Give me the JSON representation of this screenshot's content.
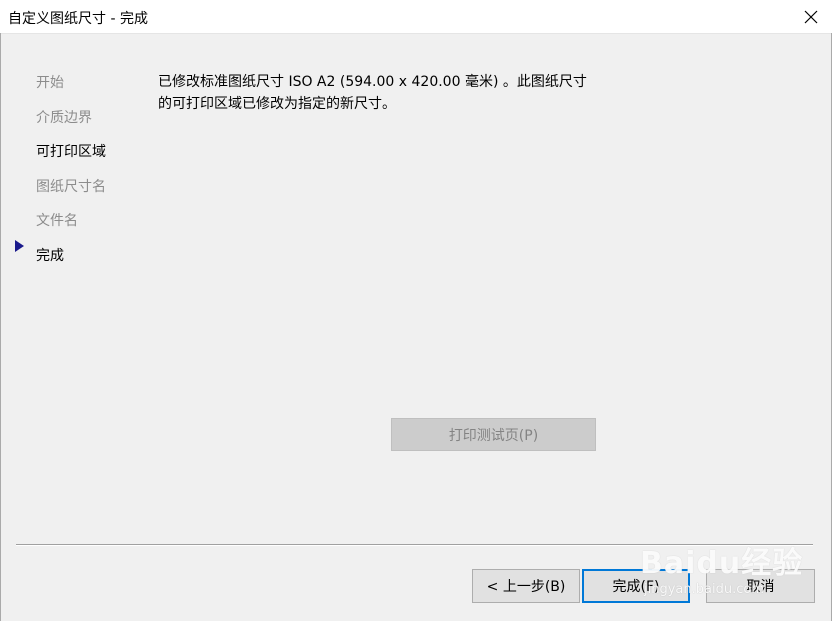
{
  "window": {
    "title": "自定义图纸尺寸 - 完成"
  },
  "steps": [
    {
      "label": "开始",
      "state": "disabled"
    },
    {
      "label": "介质边界",
      "state": "disabled"
    },
    {
      "label": "可打印区域",
      "state": "enabled"
    },
    {
      "label": "图纸尺寸名",
      "state": "disabled"
    },
    {
      "label": "文件名",
      "state": "disabled"
    },
    {
      "label": "完成",
      "state": "current"
    }
  ],
  "message": {
    "line1": "已修改标准图纸尺寸 ISO A2 (594.00 x 420.00 毫米) 。此图纸尺寸",
    "line2": "的可打印区域已修改为指定的新尺寸。"
  },
  "buttons": {
    "print_test": "打印测试页(P)",
    "back": "< 上一步(B)",
    "finish": "完成(F)",
    "cancel": "取消"
  },
  "watermark": {
    "brand": "Baidu经验",
    "url": "jingyan.baidu.com"
  },
  "colors": {
    "current_step_arrow": "#1a1a8c",
    "default_button_border": "#0078d7",
    "disabled_text": "#8c8c8c"
  }
}
